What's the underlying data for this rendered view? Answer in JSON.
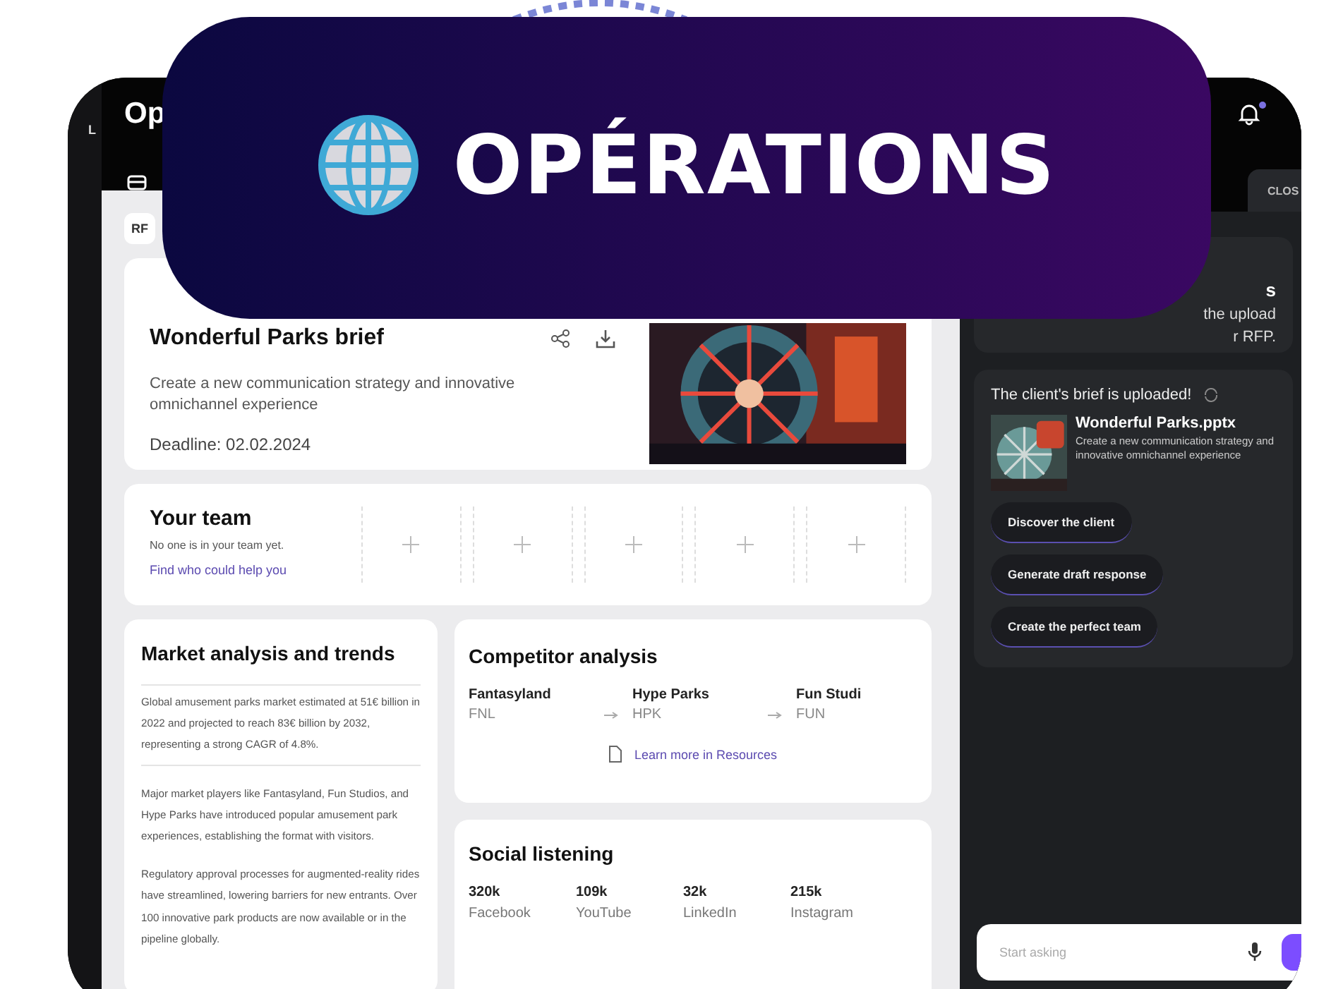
{
  "banner": {
    "title": "OPÉRATIONS"
  },
  "app": {
    "logo_text": "Op",
    "left_rail": {
      "label": "L"
    },
    "notifications": {
      "unread": true
    },
    "tabs": [
      {
        "label": "RF",
        "selected": true
      }
    ],
    "brief": {
      "title": "Wonderful Parks brief",
      "description": "Create a new communication strategy and innovative omnichannel experience",
      "deadline": "Deadline: 02.02.2024"
    },
    "team": {
      "title": "Your team",
      "empty_text": "No one is in your team yet.",
      "link": "Find who could help you",
      "slots": [
        {
          "kind": "add"
        },
        {
          "kind": "add"
        },
        {
          "kind": "add"
        },
        {
          "kind": "add"
        },
        {
          "kind": "add"
        }
      ]
    },
    "market": {
      "title": "Market analysis and trends",
      "paragraphs": [
        "Global amusement parks market estimated at 51€ billion in 2022 and projected to reach 83€ billion by 2032, representing a strong CAGR of 4.8%.",
        "Major market players like Fantasyland, Fun Studios, and Hype Parks have introduced popular amusement park experiences, establishing the format with visitors.",
        "Regulatory approval processes for augmented-reality rides have streamlined, lowering barriers for new entrants. Over 100 innovative park products are now available or in the pipeline globally."
      ]
    },
    "competitors": {
      "title": "Competitor analysis",
      "items": [
        {
          "name": "Fantasyland",
          "code": "FNL"
        },
        {
          "name": "Hype Parks",
          "code": "HPK"
        },
        {
          "name": "Fun Studi",
          "code": "FUN"
        }
      ],
      "link": "Learn more in Resources"
    },
    "social": {
      "title": "Social listening",
      "stats": [
        {
          "value": "320k",
          "label": "Facebook"
        },
        {
          "value": "109k",
          "label": "YouTube"
        },
        {
          "value": "32k",
          "label": "LinkedIn"
        },
        {
          "value": "215k",
          "label": "Instagram"
        }
      ]
    }
  },
  "assistant": {
    "close_tab": "CLOS",
    "intro_card": {
      "heading_fragment": "s",
      "lines": [
        "the upload",
        "r RFP."
      ]
    },
    "message": {
      "text": "The client's brief is uploaded!",
      "file": {
        "name": "Wonderful Parks.pptx",
        "description": "Create a new communication strategy and innovative omnichannel experience"
      },
      "actions": [
        "Discover the client",
        "Generate draft response",
        "Create the perfect team"
      ]
    },
    "input": {
      "placeholder": "Start asking"
    }
  }
}
